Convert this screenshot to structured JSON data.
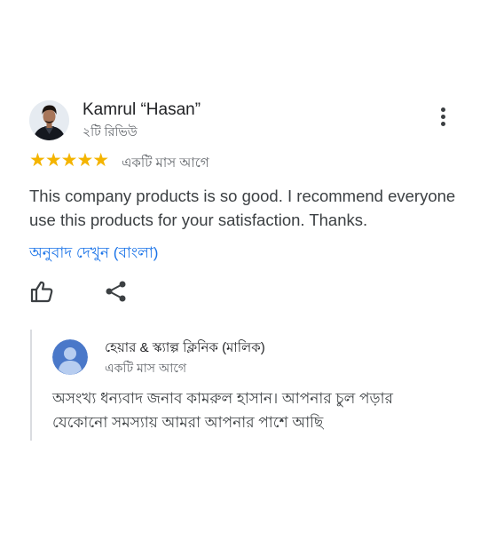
{
  "review": {
    "author_name": "Kamrul “Hasan”",
    "review_count": "২টি রিভিউ",
    "rating": 5,
    "stars": "★★★★★",
    "date": "একটি মাস আগে",
    "text": "This company products is so good. I recommend everyone use this products for your satisfaction. Thanks.",
    "translate_link": "অনুবাদ দেখুন (বাংলা)"
  },
  "owner_reply": {
    "name": "হেয়ার & স্ক্যাল্প ক্লিনিক (মালিক)",
    "date": "একটি মাস আগে",
    "text": "অসংখ্য ধন্যবাদ জনাব কামরুল হাসান। আপনার চুল পড়ার যেকোনো সমস্যায় আমরা আপনার পাশে আছি"
  },
  "colors": {
    "star": "#f4b400",
    "link": "#1a73e8",
    "owner_avatar": "#4a78c9"
  }
}
